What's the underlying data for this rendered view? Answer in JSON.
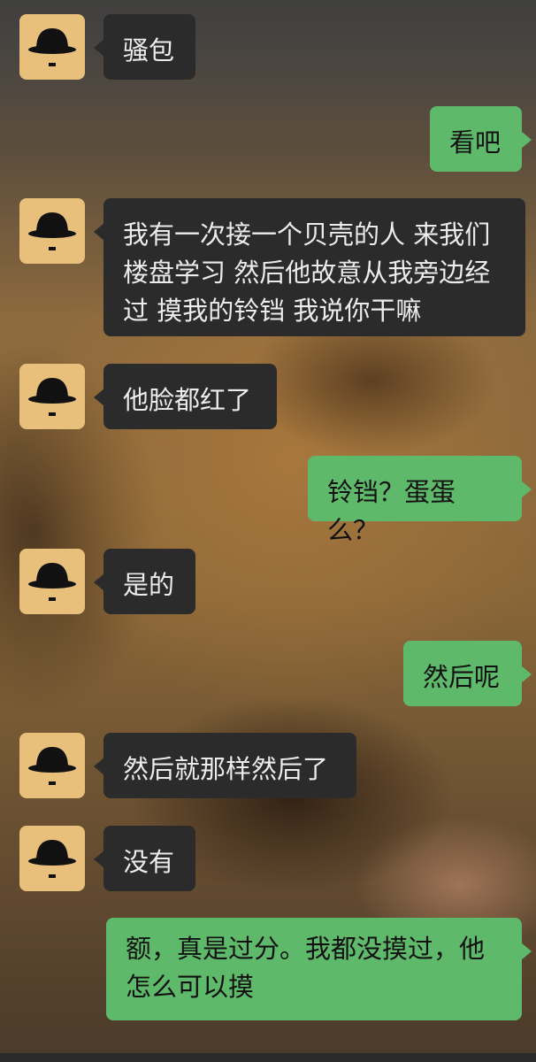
{
  "messages": [
    {
      "side": "left",
      "text": "骚包",
      "avatar_icon": "bowler-hat-mustache-icon"
    },
    {
      "side": "right",
      "text": "看吧"
    },
    {
      "side": "left",
      "text": "我有一次接一个贝壳的人 来我们楼盘学习 然后他故意从我旁边经过 摸我的铃铛 我说你干嘛",
      "avatar_icon": "bowler-hat-mustache-icon"
    },
    {
      "side": "left",
      "text": "他脸都红了",
      "avatar_icon": "bowler-hat-mustache-icon"
    },
    {
      "side": "right",
      "text": "铃铛？蛋蛋么？"
    },
    {
      "side": "left",
      "text": "是的",
      "avatar_icon": "bowler-hat-mustache-icon"
    },
    {
      "side": "right",
      "text": "然后呢"
    },
    {
      "side": "left",
      "text": "然后就那样然后了",
      "avatar_icon": "bowler-hat-mustache-icon"
    },
    {
      "side": "left",
      "text": "没有",
      "avatar_icon": "bowler-hat-mustache-icon"
    },
    {
      "side": "right",
      "text": "额，真是过分。我都没摸过，他怎么可以摸"
    }
  ],
  "colors": {
    "left_bubble": "#2b2b2b",
    "right_bubble": "#5fb96b",
    "avatar_bg": "#e8c07c"
  }
}
